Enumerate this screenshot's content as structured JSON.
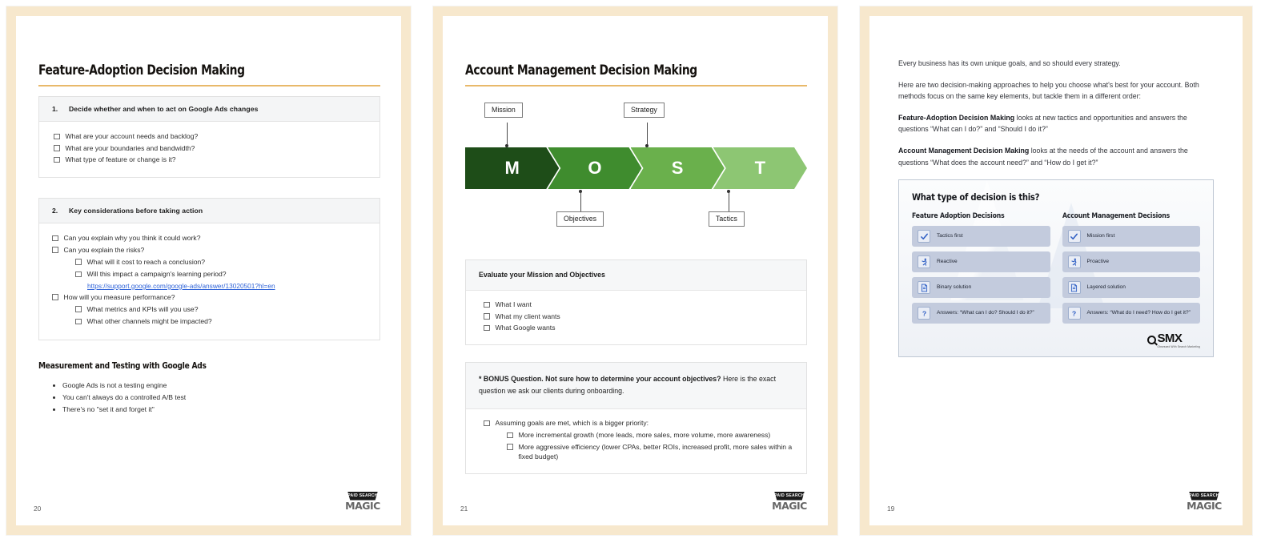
{
  "pages": [
    {
      "number": "20",
      "title": "Feature-Adoption Decision Making",
      "card1": {
        "num": "1.",
        "heading": "Decide whether and when to act on Google Ads changes",
        "items": [
          "What are your account needs  and backlog?",
          "What are your boundaries and bandwidth?",
          "What  type of feature or change is it?"
        ]
      },
      "card2": {
        "num": "2.",
        "heading": "Key considerations before taking action",
        "items": [
          {
            "text": "Can you explain why you think it could work?",
            "level": 0
          },
          {
            "text": "Can you explain the risks?",
            "level": 0
          },
          {
            "text": "What will it cost to reach a conclusion?",
            "level": 1
          },
          {
            "text": "Will this impact a campaign's learning period?",
            "level": 1
          },
          {
            "text": "How will you measure performance?",
            "level": 0
          },
          {
            "text": "What metrics and KPIs will you use?",
            "level": 1
          },
          {
            "text": "What other channels might be impacted?",
            "level": 1
          }
        ],
        "link": "https://support.google.com/google-ads/answer/13020501?hl=en"
      },
      "section": {
        "heading": "Measurement and Testing with Google Ads",
        "bullets": [
          "Google Ads is not a testing engine",
          "You can't always do a controlled A/B test",
          "There's no \"set it and forget it\""
        ]
      }
    },
    {
      "number": "21",
      "title": "Account Management Decision Making",
      "most": {
        "letters": [
          "M",
          "O",
          "S",
          "T"
        ],
        "colors": [
          "#1e4d18",
          "#3f8c2e",
          "#6ab04c",
          "#8dc673"
        ],
        "labels_top": [
          "Mission",
          "Strategy"
        ],
        "labels_bottom": [
          "Objectives",
          "Tactics"
        ]
      },
      "evaluate": {
        "heading": "Evaluate your Mission and Objectives",
        "items": [
          "What I want",
          "What my client wants",
          "What Google wants"
        ]
      },
      "bonus": {
        "lead": "* BONUS Question. Not sure how to determine your account objectives?",
        "tail": " Here is the exact question we ask our clients during onboarding.",
        "question": "Assuming goals are met, which is a bigger priority:",
        "options": [
          "More incremental growth (more leads, more sales, more volume, more awareness)",
          "More aggressive efficiency (lower CPAs, better ROIs, increased profit, more sales within a fixed budget)"
        ]
      }
    },
    {
      "number": "19",
      "prose": [
        {
          "lead": "",
          "text": "Every business has its own unique goals, and so should every strategy."
        },
        {
          "lead": "",
          "text": "Here are two decision-making approaches to help you choose what's best for your account. Both methods focus on the same key elements, but tackle them in a different order:"
        },
        {
          "lead": "Feature-Adoption Decision Making",
          "text": " looks at new tactics and opportunities and answers the questions “What can I do?” and “Should I do it?”"
        },
        {
          "lead": "Account Management Decision Making",
          "text": " looks at the needs of the account and answers the questions “What does the account need?” and “How do I get it?”"
        }
      ],
      "graphic": {
        "title": "What type of decision is this?",
        "columns": [
          {
            "heading": "Feature Adoption Decisions",
            "rows": [
              {
                "icon": "check-icon",
                "label": "Tactics first"
              },
              {
                "icon": "running-person-icon",
                "label": "Reactive"
              },
              {
                "icon": "document-icon",
                "label": "Binary solution"
              },
              {
                "icon": "question-mark-icon",
                "label": "Answers: “What can I do? Should I do it?”"
              }
            ]
          },
          {
            "heading": "Account Management Decisions",
            "rows": [
              {
                "icon": "check-icon",
                "label": "Mission first"
              },
              {
                "icon": "running-person-icon",
                "label": "Proactive"
              },
              {
                "icon": "document-icon",
                "label": "Layered solution"
              },
              {
                "icon": "question-mark-icon",
                "label": "Answers: “What do I need? How do I get it?”"
              }
            ]
          }
        ],
        "brand": {
          "name": "SMX",
          "tagline": "Obsessed With Search Marketing"
        }
      }
    }
  ],
  "logo": {
    "top": "PAID SEARCH",
    "bottom": "MAGIC"
  },
  "theme": {
    "frame": "#f7e8cd",
    "rule": "#e8b96a",
    "link": "#2f63d8",
    "chip": "#c3cbdd"
  }
}
